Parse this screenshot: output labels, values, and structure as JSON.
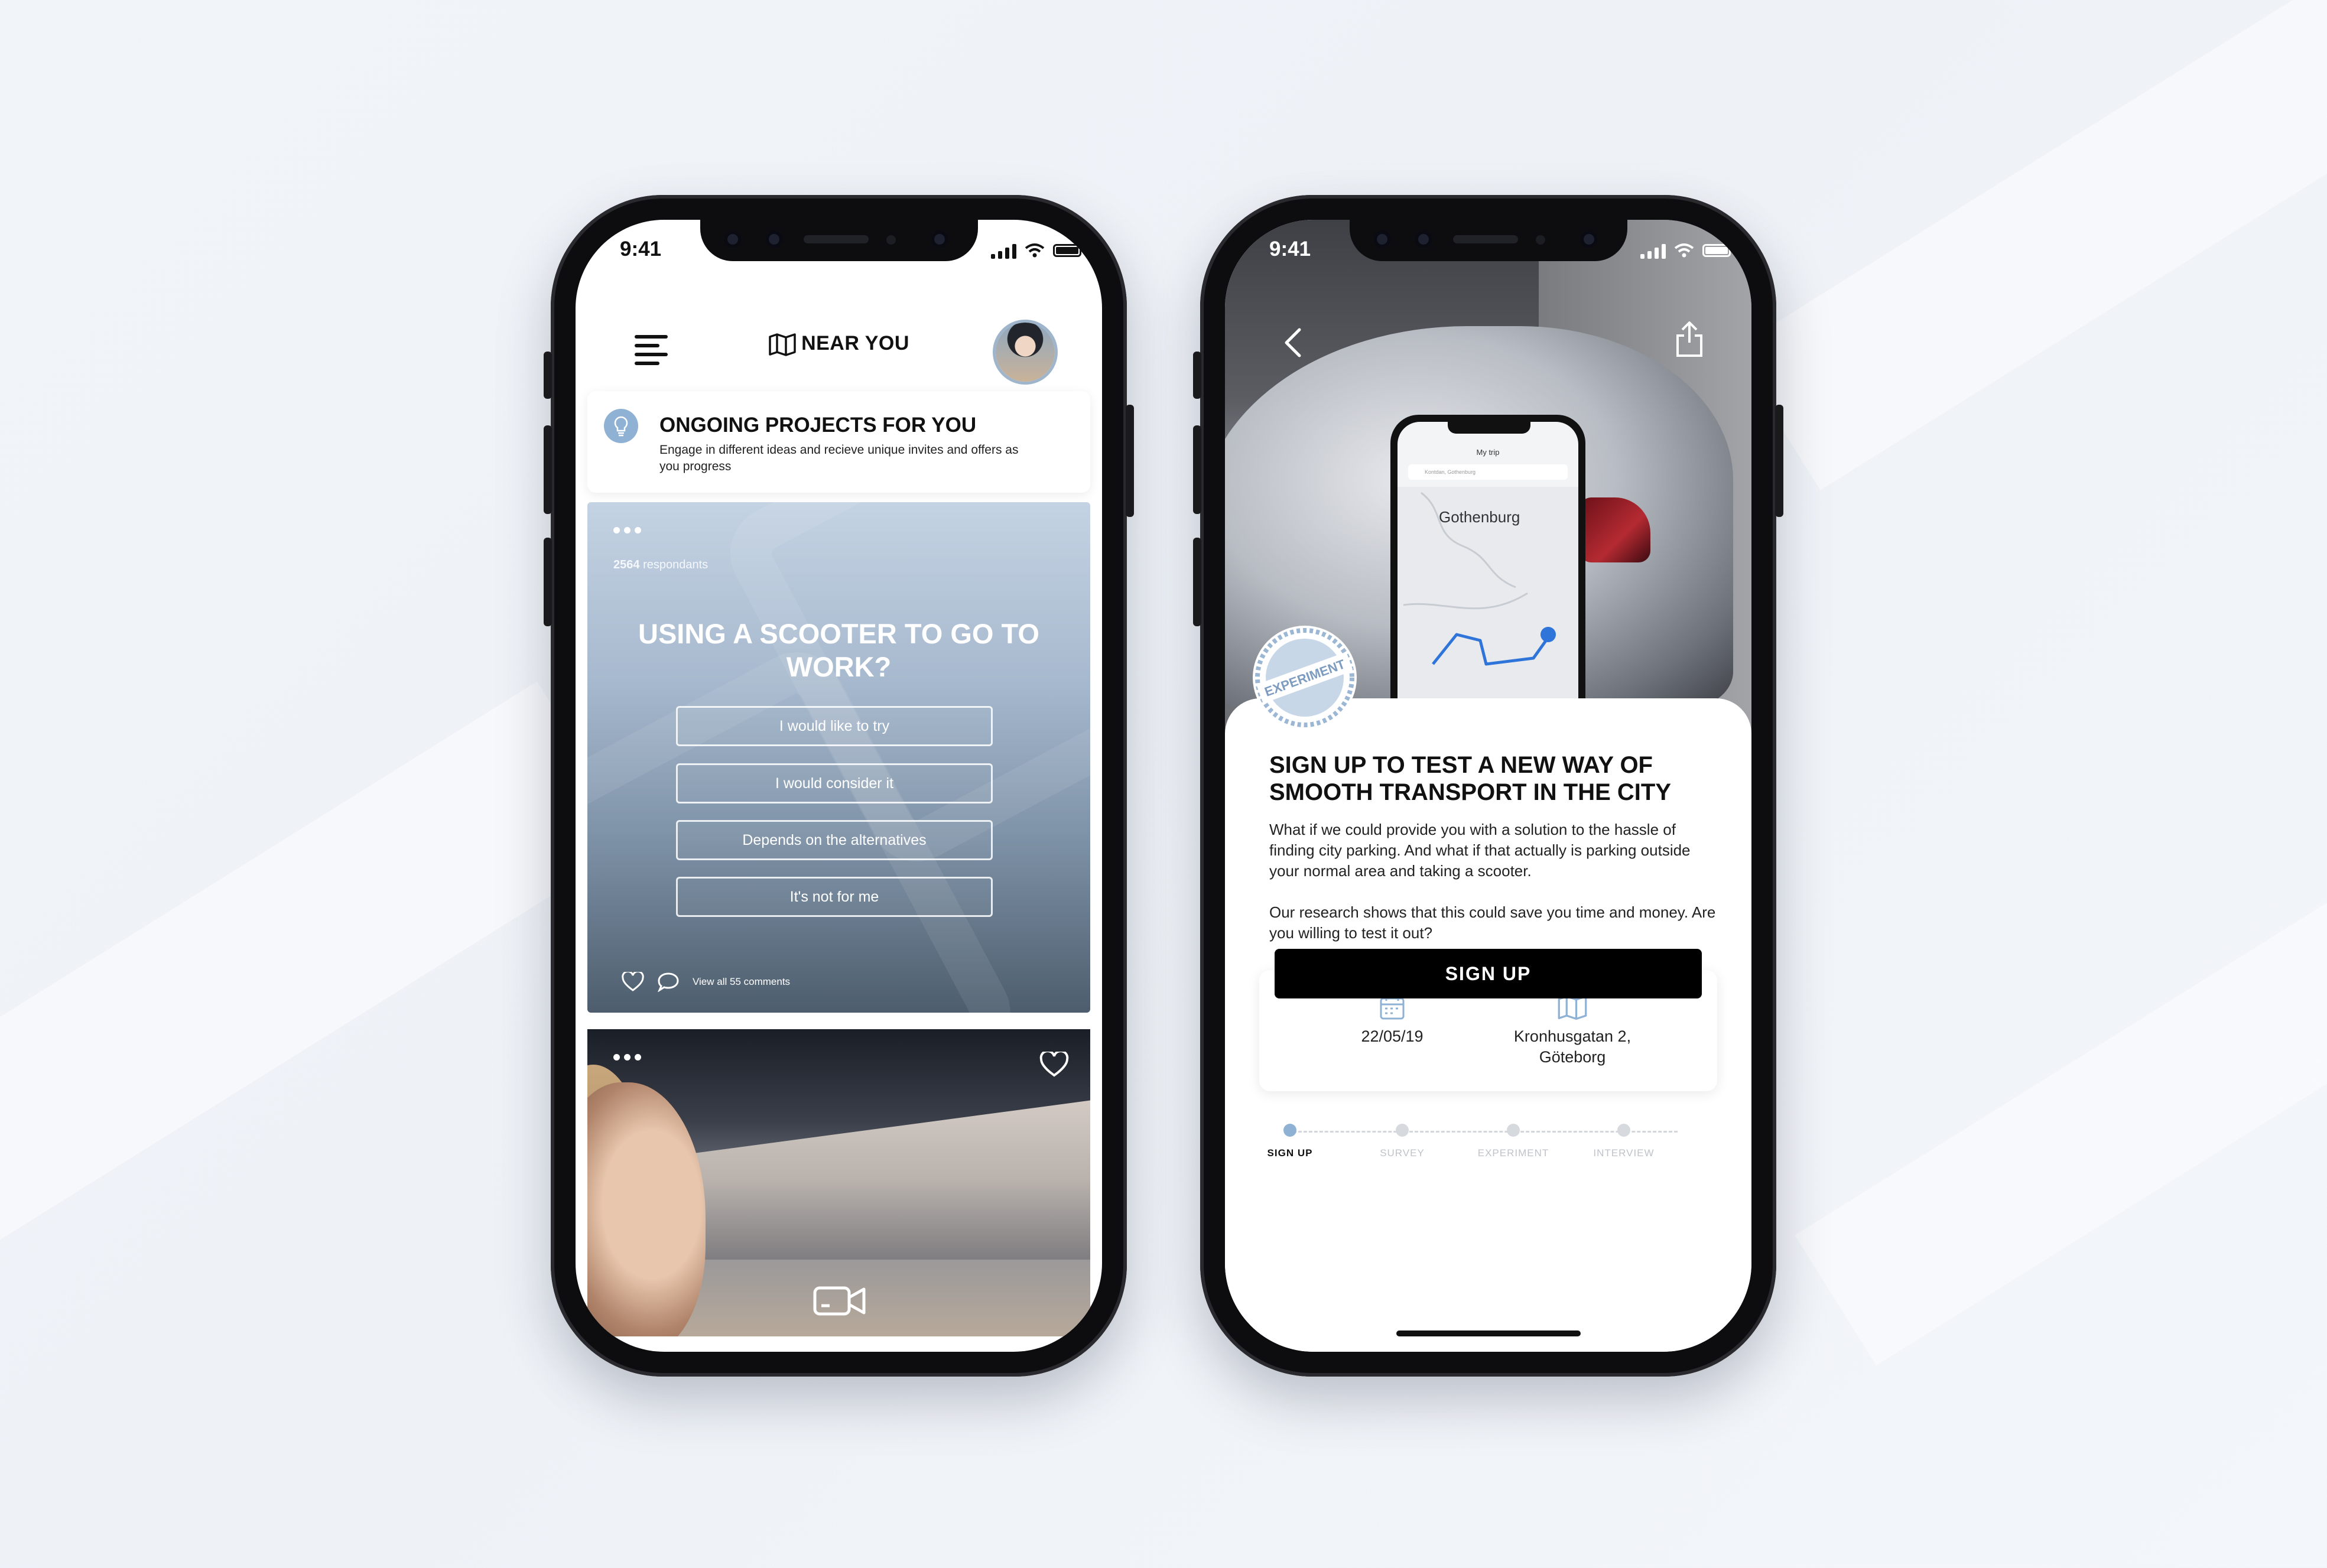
{
  "status": {
    "time": "9:41"
  },
  "phone1": {
    "header": {
      "title": "NEAR YOU"
    },
    "ongoing": {
      "title": "ONGOING PROJECTS FOR YOU",
      "subtitle": "Engage in different ideas and recieve unique invites and offers as you progress"
    },
    "survey": {
      "respondants_count": "2564",
      "respondants_label": "respondants",
      "question": "USING A SCOOTER TO GO TO WORK?",
      "options": [
        "I would like to try",
        "I would consider it",
        "Depends on the alternatives",
        "It's not for me"
      ],
      "comments_link": "View all 55 comments"
    }
  },
  "phone2": {
    "mini": {
      "title": "My trip",
      "search": "Kontdan, Gothenburg",
      "city": "Gothenburg"
    },
    "stamp": "EXPERIMENT",
    "title": "SIGN UP TO TEST A NEW WAY OF SMOOTH TRANSPORT IN THE CITY",
    "paragraph1": "What if we could provide you with a solution to the hassle of finding city parking. And what if that actually is parking outside your normal area and taking a scooter.",
    "paragraph2": "Our research shows that this could save you time and money. Are you willing to test it out?",
    "date": "22/05/19",
    "location_line1": "Kronhusgatan 2,",
    "location_line2": "Göteborg",
    "steps": [
      "SIGN UP",
      "SURVEY",
      "EXPERIMENT",
      "INTERVIEW"
    ],
    "active_step": 0,
    "signup_button": "SIGN UP"
  },
  "colors": {
    "accent": "#8fb1d3",
    "button": "#000000",
    "background": "#f1f4f9"
  }
}
